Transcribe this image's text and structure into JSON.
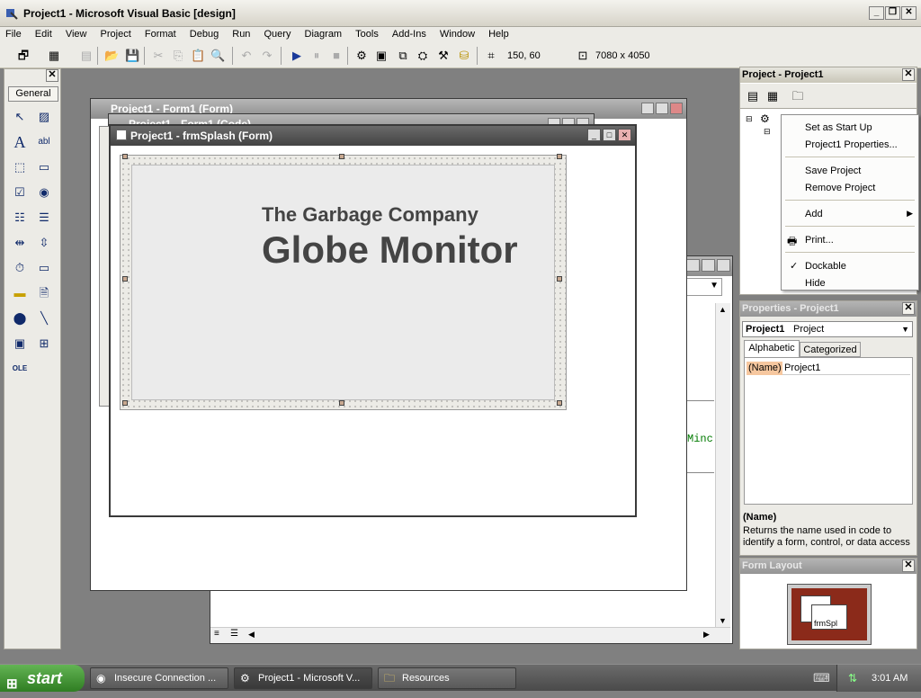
{
  "window": {
    "title": "Project1 - Microsoft Visual Basic [design]"
  },
  "menu": [
    "File",
    "Edit",
    "View",
    "Project",
    "Format",
    "Debug",
    "Run",
    "Query",
    "Diagram",
    "Tools",
    "Add-Ins",
    "Window",
    "Help"
  ],
  "toolbar": {
    "position": "150, 60",
    "size": "7080 x 4050"
  },
  "toolbox": {
    "title": "General"
  },
  "windows": {
    "back_form": "Project1 - Form1 (Form)",
    "code_window": "Project1 - Form1 (Code)",
    "splash_form": "Project1 - frmSplash (Form)",
    "code_snippet": "Minc"
  },
  "splash": {
    "company": "The Garbage Company",
    "product": "Globe Monitor"
  },
  "project_explorer": {
    "title": "Project - Project1"
  },
  "context_menu": {
    "items": [
      "Set as Start Up",
      "Project1 Properties...",
      "Save Project",
      "Remove Project",
      "Add",
      "Print...",
      "Dockable",
      "Hide"
    ],
    "checked": "Dockable"
  },
  "properties": {
    "title": "Properties - Project1",
    "object_name": "Project1",
    "object_type": "Project",
    "tabs": [
      "Alphabetic",
      "Categorized"
    ],
    "rows": [
      {
        "name": "(Name)",
        "value": "Project1"
      }
    ],
    "desc_title": "(Name)",
    "desc_text": "Returns the name used in code to identify a form, control, or data access"
  },
  "form_layout": {
    "title": "Form Layout",
    "label": "frmSpl"
  },
  "taskbar": {
    "start": "start",
    "tasks": [
      "Insecure Connection ...",
      "Project1 - Microsoft V...",
      "Resources"
    ],
    "clock": "3:01 AM"
  },
  "colors": {
    "accent": "#8b2a1a",
    "name_highlight": "#f6c79f",
    "code_green": "#007a00"
  }
}
